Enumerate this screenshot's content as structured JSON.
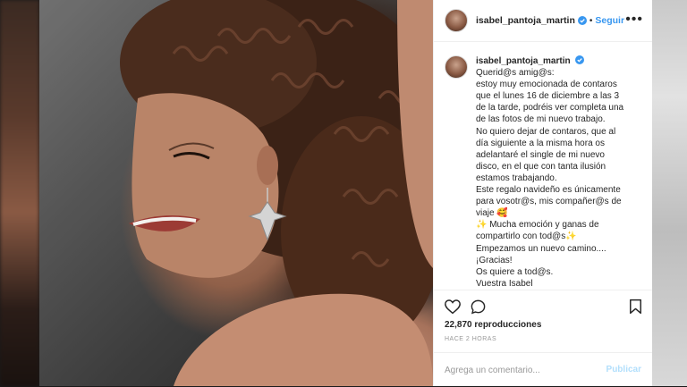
{
  "header": {
    "username": "isabel_pantoja_martin",
    "separator": "•",
    "follow_label": "Seguir",
    "more_label": "•••"
  },
  "caption": {
    "username": "isabel_pantoja_martin",
    "lines": [
      "Querid@s amig@s:",
      "estoy muy emocionada de contaros",
      "que el lunes 16 de diciembre a las 3",
      "de la tarde, podréis ver completa una",
      "de las fotos de mi nuevo trabajo.",
      "No quiero dejar de contaros, que al",
      "día siguiente a la misma hora os",
      "adelantaré el single de mi nuevo",
      "disco, en el que con tanta ilusión",
      "estamos trabajando.",
      "Este regalo navideño es únicamente",
      "para vosotr@s, mis compañer@s de",
      "viaje 🥰",
      "✨ Mucha emoción y ganas de",
      "compartirlo con tod@s✨",
      "Empezamos un nuevo camino....",
      "¡Gracias!",
      "Os quiere a tod@s.",
      "Vuestra Isabel"
    ]
  },
  "stats": {
    "likes": "22,870 reproducciones",
    "time": "HACE 2 HORAS"
  },
  "comment": {
    "placeholder": "Agrega un comentario...",
    "publish_label": "Publicar"
  },
  "colors": {
    "link": "#3897f0",
    "publish_disabled": "#b2dffc",
    "verified": "#3897f0"
  },
  "icons": [
    "heart-icon",
    "comment-icon",
    "bookmark-icon",
    "verified-icon",
    "more-icon"
  ]
}
